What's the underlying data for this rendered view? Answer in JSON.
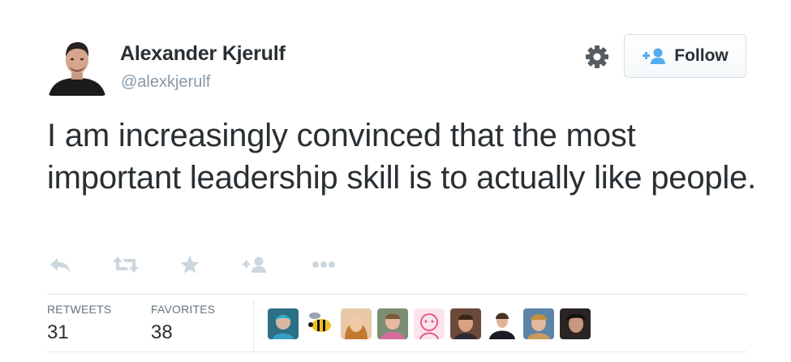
{
  "tweet": {
    "author": {
      "fullname": "Alexander Kjerulf",
      "handle": "@alexkjerulf",
      "avatar_icon": "profile-photo"
    },
    "follow_button": {
      "label": "Follow",
      "icon": "add-user-icon"
    },
    "settings_icon": "gear-icon",
    "text": "I am increasingly convinced that the most important leadership skill is to actually like people.",
    "actions": [
      "reply-icon",
      "retweet-icon",
      "favorite-icon",
      "follow-icon",
      "more-icon"
    ],
    "stats": [
      {
        "label": "RETWEETS",
        "value": "31"
      },
      {
        "label": "FAVORITES",
        "value": "38"
      }
    ],
    "favorited_by_avatar_count": 9
  },
  "colors": {
    "text": "#292f33",
    "muted": "#8899a6",
    "action_icons": "#ccd6dd",
    "follow_icon": "#55acee",
    "divider": "#e1e8ed"
  }
}
